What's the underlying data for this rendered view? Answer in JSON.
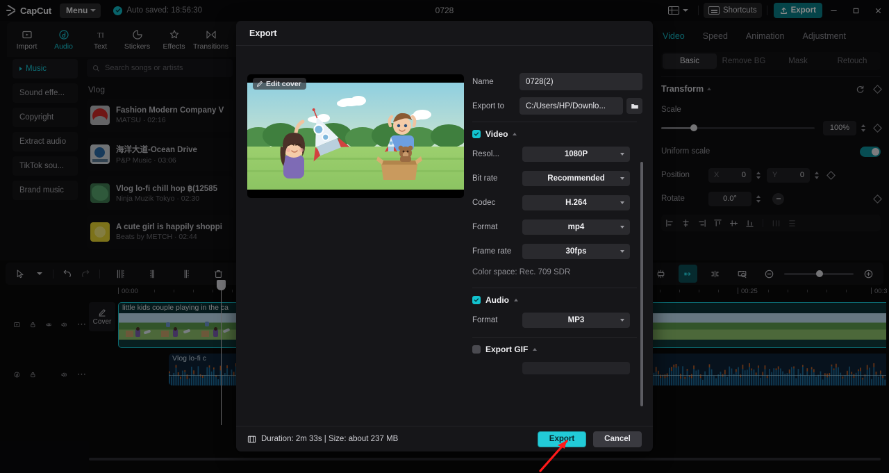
{
  "titlebar": {
    "app_name": "CapCut",
    "menu_label": "Menu",
    "autosave_text": "Auto  saved: 18:56:30",
    "project_title": "0728",
    "shortcuts_label": "Shortcuts",
    "export_label": "Export",
    "minimize": "—",
    "maximize": "❐",
    "close": "✕",
    "accent": "#0fb8c4"
  },
  "left_panel": {
    "tabs": [
      {
        "label": "Import",
        "icon": "import-icon",
        "active": false
      },
      {
        "label": "Audio",
        "icon": "audio-icon",
        "active": true
      },
      {
        "label": "Text",
        "icon": "text-icon",
        "active": false
      },
      {
        "label": "Stickers",
        "icon": "stickers-icon",
        "active": false
      },
      {
        "label": "Effects",
        "icon": "effects-icon",
        "active": false
      },
      {
        "label": "Transitions",
        "icon": "transitions-icon",
        "active": false
      }
    ],
    "categories": [
      {
        "label": "Music",
        "active": true
      },
      {
        "label": "Sound effe...",
        "active": false
      },
      {
        "label": "Copyright",
        "active": false
      },
      {
        "label": "Extract audio",
        "active": false
      },
      {
        "label": "TikTok sou...",
        "active": false
      },
      {
        "label": "Brand music",
        "active": false
      }
    ],
    "search_placeholder": "Search songs or artists",
    "section_label": "Vlog",
    "songs": [
      {
        "title": "Fashion Modern Company V",
        "sub": "MATSU · 02:16",
        "thumb": "red"
      },
      {
        "title": "海洋大道-Ocean Drive",
        "sub": "P&P Music · 03:06",
        "thumb": "blue"
      },
      {
        "title": "Vlog  lo-fi chill hop ฿(12585",
        "sub": "Ninja Muzik Tokyo · 02:30",
        "thumb": "green"
      },
      {
        "title": "A cute girl is happily shoppi",
        "sub": "Beats by METCH · 02:44",
        "thumb": "yellow"
      }
    ]
  },
  "right_panel": {
    "tabs": [
      {
        "label": "Video",
        "active": true
      },
      {
        "label": "Speed",
        "active": false
      },
      {
        "label": "Animation",
        "active": false
      },
      {
        "label": "Adjustment",
        "active": false
      }
    ],
    "segments": [
      {
        "label": "Basic",
        "active": true
      },
      {
        "label": "Remove BG",
        "active": false
      },
      {
        "label": "Mask",
        "active": false
      },
      {
        "label": "Retouch",
        "active": false
      }
    ],
    "transform": {
      "title": "Transform",
      "scale_label": "Scale",
      "scale_value": "100%",
      "uniform_label": "Uniform scale",
      "uniform_on": true,
      "position_label": "Position",
      "position_x_axis": "X",
      "position_x": "0",
      "position_y_axis": "Y",
      "position_y": "0",
      "rotate_label": "Rotate",
      "rotate_value": "0.0°"
    }
  },
  "timeline": {
    "tools_left": [
      {
        "name": "select-tool-icon"
      },
      {
        "name": "tool-dropdown-caret-icon"
      },
      {
        "name": "undo-icon"
      },
      {
        "name": "redo-icon"
      },
      {
        "name": "split-icon"
      },
      {
        "name": "trim-left-icon"
      },
      {
        "name": "trim-right-icon"
      },
      {
        "name": "delete-icon"
      },
      {
        "name": "freeze-icon"
      },
      {
        "name": "mirror-icon"
      }
    ],
    "tools_right": [
      {
        "name": "auto-fit-icon"
      },
      {
        "name": "magnet-snap-icon"
      },
      {
        "name": "link-av-icon"
      },
      {
        "name": "adsorption-icon"
      },
      {
        "name": "preview-axis-icon"
      },
      {
        "name": "zoom-out-icon"
      },
      {
        "name": "zoom-in-icon"
      }
    ],
    "ruler_labels": [
      "00:00",
      "00:25",
      "00:3"
    ],
    "cover_label": "Cover",
    "video_clip_title": "little kids couple playing in the ca",
    "audio_clip_title": "Vlog  lo-fi c"
  },
  "modal": {
    "title": "Export",
    "edit_cover_label": "Edit cover",
    "name_label": "Name",
    "name_value": "0728(2)",
    "export_to_label": "Export to",
    "export_to_value": "C:/Users/HP/Downlo...",
    "video": {
      "group_label": "Video",
      "checked": true,
      "fields": [
        {
          "label": "Resol...",
          "value": "1080P"
        },
        {
          "label": "Bit rate",
          "value": "Recommended"
        },
        {
          "label": "Codec",
          "value": "H.264"
        },
        {
          "label": "Format",
          "value": "mp4"
        },
        {
          "label": "Frame rate",
          "value": "30fps"
        }
      ],
      "color_space": "Color space: Rec. 709 SDR"
    },
    "audio": {
      "group_label": "Audio",
      "checked": true,
      "fields": [
        {
          "label": "Format",
          "value": "MP3"
        }
      ]
    },
    "gif": {
      "group_label": "Export GIF",
      "checked": false
    },
    "footer": {
      "duration_text": "Duration: 2m 33s | Size: about 237 MB",
      "export_label": "Export",
      "cancel_label": "Cancel"
    }
  },
  "colors": {
    "accent_teal": "#22cbd8",
    "accent_dark_teal": "#0b7e87",
    "panel_bg": "#0d0d0f",
    "modal_bg": "#161619",
    "annotation_arrow": "#ff1a1a"
  }
}
